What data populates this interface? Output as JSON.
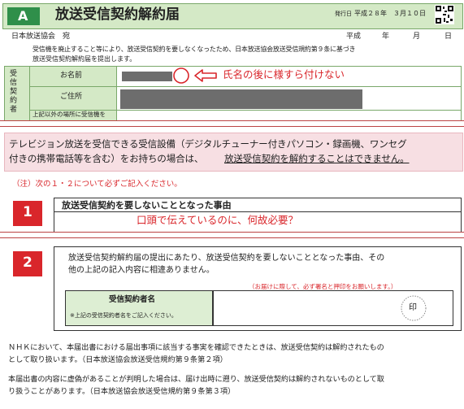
{
  "header": {
    "form_letter": "A",
    "title": "放送受信契約解約届",
    "issue_label": "発行日",
    "issue_date": "平成２８年　３月１０日",
    "addressee": "日本放送協会　宛",
    "date_era": "平成",
    "date_year": "年",
    "date_month": "月",
    "date_day": "日",
    "intro_line1": "受信機を廃止すること等により、放送受信契約を要しなくなったため、日本放送協会放送受信規約第９条に基づき",
    "intro_line2": "放送受信契約解約届を提出します。"
  },
  "contractor": {
    "side_label": "受信契約者",
    "name_label": "お名前",
    "address_label": "ご住所",
    "other_label": "上記以外の場所に受信機を",
    "annotation": "氏名の後に様すら付けない"
  },
  "notice": {
    "line1": "テレビジョン放送を受信できる受信設備（デジタルチューナー付きパソコン・録画機、ワンセグ",
    "line2a": "付きの携帯電話等を含む）をお持ちの場合は、",
    "line2b": "放送受信契約を解約することはできません。",
    "instruction": "（注）次の１・２について必ずご記入ください。"
  },
  "section1": {
    "number": "1",
    "title": "放送受信契約を要しないこととなった事由",
    "annotation": "口頭で伝えているのに、何故必要？"
  },
  "section2": {
    "number": "2",
    "text_line1": "放送受信契約解約届の提出にあたり、放送受信契約を要しないこととなった事由、その",
    "text_line2": "他の上記の記入内容に相違ありません。",
    "sign_note": "（お届けに際して、必ず署名と押印をお願いします。）",
    "name_label": "受信契約者名",
    "name_hint": "※上記の受信契約者名をご記入ください。",
    "seal": "印"
  },
  "footer": {
    "para1_line1": "ＮＨＫにおいて、本届出書における届出事項に該当する事実を確認できたときは、放送受信契約は解約されたもの",
    "para1_line2": "として取り扱います。（日本放送協会放送受信規約第９条第２項）",
    "para2_line1": "本届出書の内容に虚偽があることが判明した場合は、届け出時に遡り、放送受信契約は解約されないものとして取",
    "para2_line2": "り扱うことがあります。（日本放送協会放送受信規約第９条第３項）"
  },
  "colors": {
    "header_green": "#d4e9c6",
    "letter_green": "#2f8f4a",
    "notice_pink": "#f7dfe3",
    "accent_red": "#d9262b"
  }
}
